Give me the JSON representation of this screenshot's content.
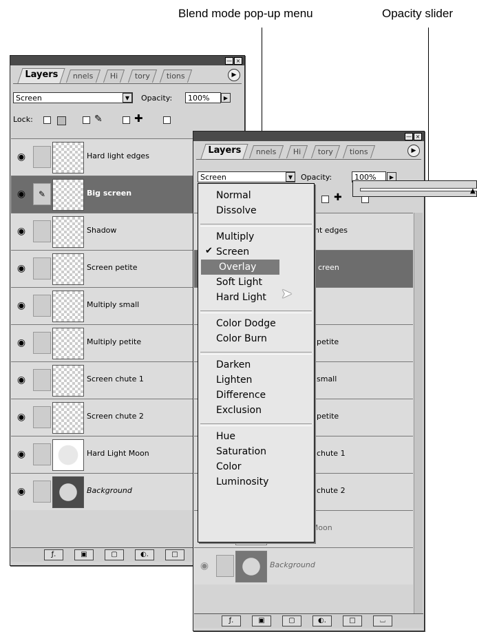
{
  "callouts": {
    "blend_menu": "Blend mode pop-up menu",
    "opacity_slider": "Opacity slider"
  },
  "back_panel": {
    "tabs": [
      "Layers",
      "nnels",
      "Hi",
      "tory",
      "tions"
    ],
    "blend_value": "Screen",
    "opacity_label": "Opacity:",
    "opacity_value": "100%",
    "lock_label": "Lock:",
    "layers": [
      {
        "name": "Hard light edges"
      },
      {
        "name": "Big screen",
        "selected": true
      },
      {
        "name": "Shadow"
      },
      {
        "name": "Screen petite"
      },
      {
        "name": "Multiply small"
      },
      {
        "name": "Multiply petite"
      },
      {
        "name": "Screen chute 1"
      },
      {
        "name": "Screen chute 2"
      },
      {
        "name": "Hard Light Moon"
      },
      {
        "name": "Background"
      }
    ]
  },
  "front_panel": {
    "tabs": [
      "Layers",
      "nnels",
      "Hi",
      "tory",
      "tions"
    ],
    "blend_value": "Screen",
    "opacity_label": "Opacity:",
    "opacity_value": "100%",
    "layer_fragments": [
      "ht edges",
      "creen",
      "",
      "petite",
      "small",
      "petite",
      "chute 1",
      "chute 2",
      "Hard Light Moon",
      "Background"
    ]
  },
  "blend_menu": {
    "groups": [
      [
        "Normal",
        "Dissolve"
      ],
      [
        "Multiply",
        "Screen",
        "Overlay",
        "Soft Light",
        "Hard Light"
      ],
      [
        "Color Dodge",
        "Color Burn"
      ],
      [
        "Darken",
        "Lighten",
        "Difference",
        "Exclusion"
      ],
      [
        "Hue",
        "Saturation",
        "Color",
        "Luminosity"
      ]
    ],
    "checked": "Screen",
    "highlighted": "Overlay"
  }
}
